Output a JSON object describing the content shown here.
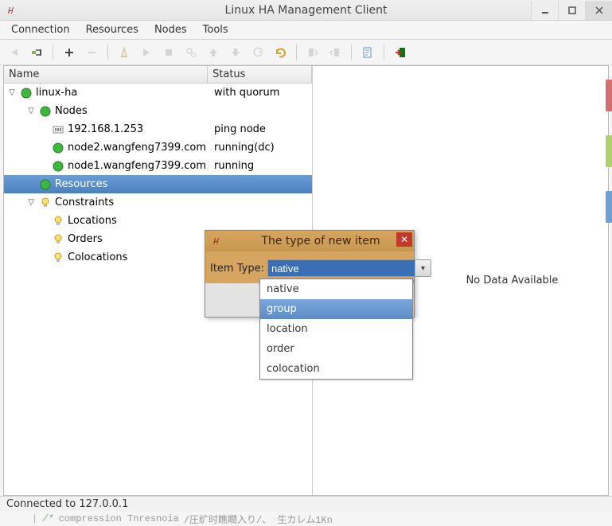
{
  "window": {
    "title": "Linux HA Management Client"
  },
  "menu": {
    "connection": "Connection",
    "resources": "Resources",
    "nodes": "Nodes",
    "tools": "Tools"
  },
  "tree": {
    "columns": {
      "name": "Name",
      "status": "Status"
    },
    "root": {
      "label": "linux-ha",
      "status": "with quorum"
    },
    "nodes_group": {
      "label": "Nodes"
    },
    "nodes": [
      {
        "label": "192.168.1.253",
        "status": "ping node",
        "type": "ping"
      },
      {
        "label": "node2.wangfeng7399.com",
        "status": "running(dc)",
        "type": "node"
      },
      {
        "label": "node1.wangfeng7399.com",
        "status": "running",
        "type": "node"
      }
    ],
    "resources": {
      "label": "Resources"
    },
    "constraints": {
      "label": "Constraints"
    },
    "constraint_children": [
      {
        "label": "Locations"
      },
      {
        "label": "Orders"
      },
      {
        "label": "Colocations"
      }
    ]
  },
  "right_panel": {
    "no_data": "No Data Available"
  },
  "statusbar": {
    "text": "Connected to 127.0.0.1"
  },
  "dialog": {
    "title": "The type of new item",
    "label": "Item Type:",
    "value": "native",
    "options": [
      "native",
      "group",
      "location",
      "order",
      "colocation"
    ],
    "highlighted": "group"
  },
  "garbage": "compression Tnresnoia"
}
